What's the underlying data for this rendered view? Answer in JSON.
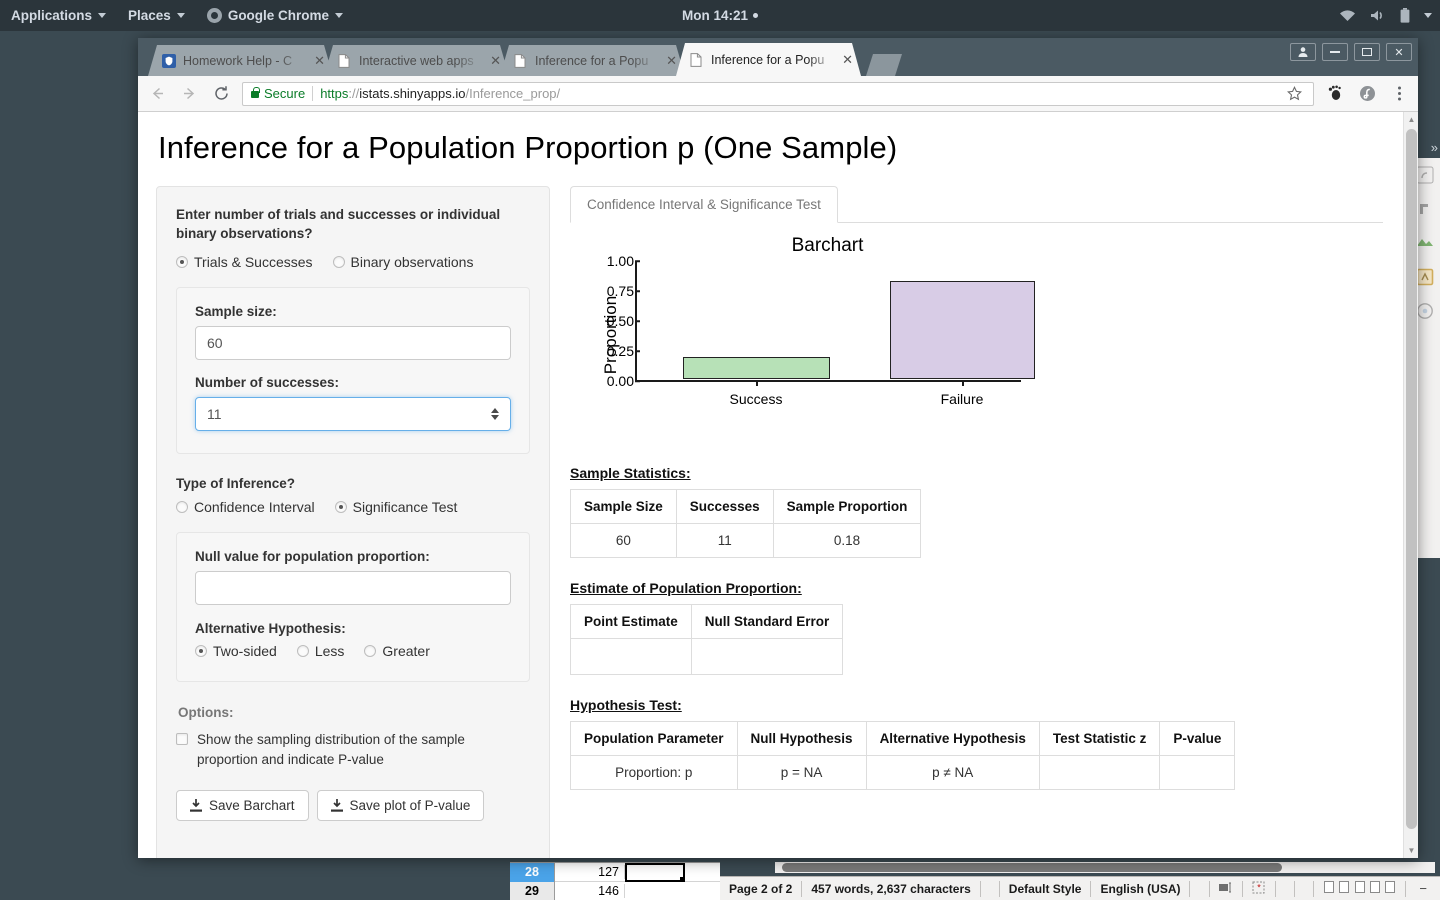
{
  "gnome": {
    "applications": "Applications",
    "places": "Places",
    "app_name": "Google Chrome",
    "clock": "Mon 14:21"
  },
  "browser": {
    "tabs": [
      {
        "title": "Homework Help - C",
        "favicon": "shield-icon",
        "active": false
      },
      {
        "title": "Interactive web apps",
        "favicon": "page-icon",
        "active": false
      },
      {
        "title": "Inference for a Popu",
        "favicon": "page-icon",
        "active": false
      },
      {
        "title": "Inference for a Popu",
        "favicon": "page-icon",
        "active": true
      }
    ],
    "security_label": "Secure",
    "url_scheme": "https",
    "url_sep": "://",
    "url_host": "istats.shinyapps.io",
    "url_path": "/Inference_prop/"
  },
  "page": {
    "title": "Inference for a Population Proportion p (One Sample)",
    "sidebar": {
      "question": "Enter number of trials and successes or individual binary observations?",
      "input_mode_options": [
        {
          "label": "Trials & Successes",
          "checked": true
        },
        {
          "label": "Binary observations",
          "checked": false
        }
      ],
      "sample_size_label": "Sample size:",
      "sample_size_value": "60",
      "successes_label": "Number of successes:",
      "successes_value": "11",
      "inference_type_label": "Type of Inference?",
      "inference_type_options": [
        {
          "label": "Confidence Interval",
          "checked": false
        },
        {
          "label": "Significance Test",
          "checked": true
        }
      ],
      "null_value_label": "Null value for population proportion:",
      "null_value": "",
      "alternative_label": "Alternative Hypothesis:",
      "alternative_options": [
        {
          "label": "Two-sided",
          "checked": true
        },
        {
          "label": "Less",
          "checked": false
        },
        {
          "label": "Greater",
          "checked": false
        }
      ],
      "options_label": "Options:",
      "show_sampling_label": "Show the sampling distribution of the sample proportion and indicate P-value",
      "show_sampling_checked": false,
      "save_barchart_label": "Save Barchart",
      "save_pvalue_label": "Save plot of P-value"
    },
    "main": {
      "tab_label": "Confidence Interval & Significance Test",
      "sample_stats_heading": "Sample Statistics:",
      "sample_stats": {
        "headers": [
          "Sample Size",
          "Successes",
          "Sample Proportion"
        ],
        "rows": [
          [
            "60",
            "11",
            "0.18"
          ]
        ]
      },
      "estimate_heading": "Estimate of Population Proportion:",
      "estimate": {
        "headers": [
          "Point Estimate",
          "Null Standard Error"
        ],
        "rows": [
          [
            "",
            ""
          ]
        ]
      },
      "hypothesis_heading": "Hypothesis Test:",
      "hypothesis": {
        "headers": [
          "Population Parameter",
          "Null Hypothesis",
          "Alternative Hypothesis",
          "Test Statistic z",
          "P-value"
        ],
        "rows": [
          [
            "Proportion: p",
            "p = NA",
            "p ≠ NA",
            "",
            ""
          ]
        ]
      }
    }
  },
  "chart_data": {
    "type": "bar",
    "title": "Barchart",
    "xlabel": "",
    "ylabel": "Proportion",
    "categories": [
      "Success",
      "Failure"
    ],
    "values": [
      0.18,
      0.82
    ],
    "colors": [
      "#b7e1b7",
      "#d8cce6"
    ],
    "bar_border": "#222222",
    "ylim": [
      0,
      1
    ],
    "yticks": [
      "0.00",
      "0.25",
      "0.50",
      "0.75",
      "1.00"
    ],
    "ytick_values": [
      0,
      0.25,
      0.5,
      0.75,
      1
    ],
    "grid": false,
    "legend": "none"
  },
  "libreoffice": {
    "calc": {
      "rows": [
        {
          "header": "28",
          "value": "127",
          "selected": true
        },
        {
          "header": "29",
          "value": "146",
          "selected": false
        }
      ]
    },
    "status": {
      "page": "Page 2 of 2",
      "words": "457 words, 2,637 characters",
      "style": "Default Style",
      "language": "English (USA)",
      "zoom_minus": "−",
      "zoom_plus": "+"
    }
  }
}
